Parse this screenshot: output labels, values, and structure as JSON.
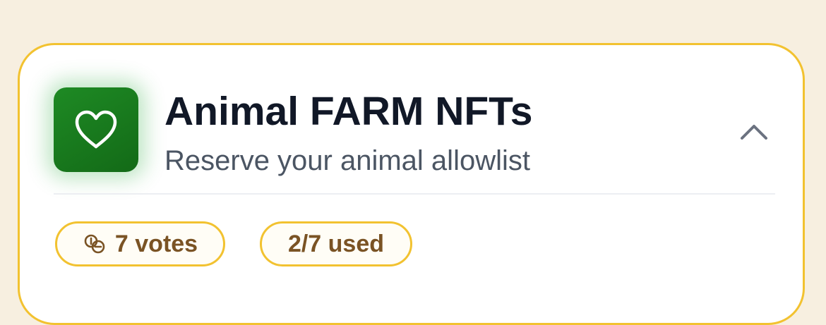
{
  "card": {
    "title": "Animal FARM NFTs",
    "subtitle": "Reserve your animal allowlist",
    "icon": "heart-icon",
    "collapse_icon": "chevron-up-icon",
    "badges": {
      "votes": {
        "icon": "coins-icon",
        "label": "7 votes"
      },
      "used": {
        "label": "2/7 used"
      }
    }
  },
  "colors": {
    "background": "#f7efe0",
    "card_border": "#f2c230",
    "app_icon_green": "#1a7d1f",
    "title": "#111827",
    "subtitle": "#4b5563",
    "badge_text": "#7a5324"
  }
}
